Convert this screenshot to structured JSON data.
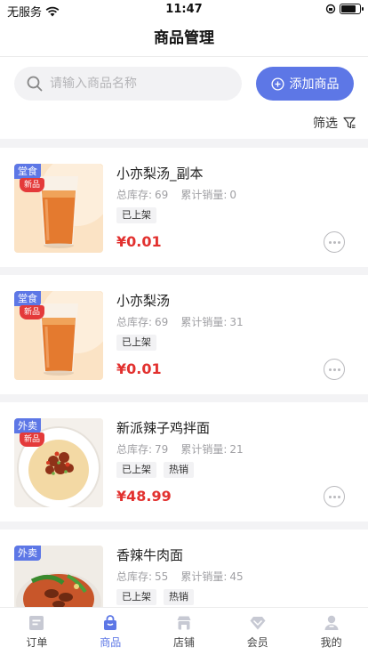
{
  "status_bar": {
    "carrier": "无服务",
    "time": "11:47",
    "battery_level": 0.8
  },
  "header": {
    "title": "商品管理"
  },
  "search": {
    "placeholder": "请输入商品名称"
  },
  "toolbar": {
    "add_label": "添加商品",
    "filter_label": "筛选"
  },
  "stat_labels": {
    "stock": "总库存:",
    "sales": "累计销量:"
  },
  "accent_color": "#5d77e6",
  "price_color": "#e2312f",
  "products": [
    {
      "type_tag": "堂食",
      "new_badge": "新品",
      "name": "小亦梨汤_副本",
      "stock": "69",
      "sales": "0",
      "tags": [
        "已上架"
      ],
      "price": "¥0.01",
      "image": "juice"
    },
    {
      "type_tag": "堂食",
      "new_badge": "新品",
      "name": "小亦梨汤",
      "stock": "69",
      "sales": "31",
      "tags": [
        "已上架"
      ],
      "price": "¥0.01",
      "image": "juice"
    },
    {
      "type_tag": "外卖",
      "new_badge": "新品",
      "name": "新派辣子鸡拌面",
      "stock": "79",
      "sales": "21",
      "tags": [
        "已上架",
        "热销"
      ],
      "price": "¥48.99",
      "image": "noodles"
    },
    {
      "type_tag": "外卖",
      "new_badge": "",
      "name": "香辣牛肉面",
      "stock": "55",
      "sales": "45",
      "tags": [
        "已上架",
        "热销"
      ],
      "price": "",
      "image": "beef-noodles"
    }
  ],
  "tabbar": [
    {
      "label": "订单",
      "icon": "order-icon",
      "active": false
    },
    {
      "label": "商品",
      "icon": "shopping-bag-icon",
      "active": true
    },
    {
      "label": "店铺",
      "icon": "store-icon",
      "active": false
    },
    {
      "label": "会员",
      "icon": "diamond-icon",
      "active": false
    },
    {
      "label": "我的",
      "icon": "user-icon",
      "active": false
    }
  ]
}
